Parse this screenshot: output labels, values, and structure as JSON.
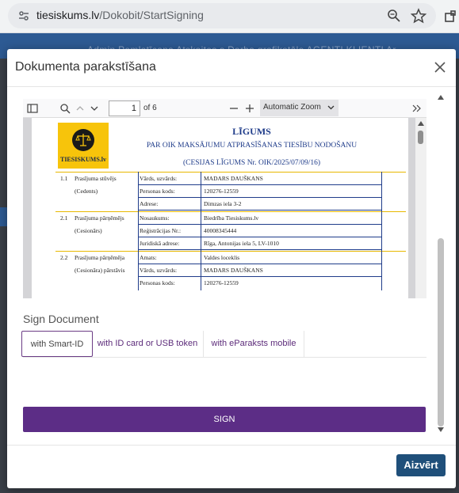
{
  "browser": {
    "url_host": "tiesiskums.lv",
    "url_path": "/Dokobit/StartSigning"
  },
  "background_app": {
    "nav_text": "Admin   Pamlatīcana   Atskaites s   Darba grafikotāle   AGENTI   KLIENTI   Ar"
  },
  "modal": {
    "title": "Dokumenta parakstīšana",
    "close_label": "Aizvērt"
  },
  "pdf_viewer": {
    "page_number": "1",
    "page_total": "of 6",
    "zoom": "Automatic Zoom"
  },
  "document": {
    "logo_text": "TIESISKUMS.lv",
    "title": "LĪGUMS",
    "subtitle": "PAR OIK MAKSĀJUMU ATPRASĪŠANAS TIESĪBU NODOŠANU",
    "ref": "(CESIJAS LĪGUMS Nr. OIK/2025/07/09/16)",
    "rows": [
      {
        "num": "1.1",
        "sec": "Prasījuma stūvējs",
        "label": "Vārds, uzvārds:",
        "value": "MADARS DAUŠKANS"
      },
      {
        "num": "",
        "sec": "(Cedents)",
        "label": "Personas kods:",
        "value": "120276-12559"
      },
      {
        "num": "",
        "sec": "",
        "label": "Adrese:",
        "value": "Dimzas iela 3-2"
      },
      {
        "num": "2.1",
        "sec": "Prasījuma pārņēmējs",
        "label": "Nosaukums:",
        "value": "Biedrība Tiesiskums.lv"
      },
      {
        "num": "",
        "sec": "(Cesionārs)",
        "label": "Reģistrācijas Nr.:",
        "value": "40008345444"
      },
      {
        "num": "",
        "sec": "",
        "label": "Juridiskā adrese:",
        "value": "Rīga, Antonijas iela 5, LV-1010"
      },
      {
        "num": "2.2",
        "sec": "Prasījuma pārņēmēja",
        "label": "Amats:",
        "value": "Valdes loceklis"
      },
      {
        "num": "",
        "sec": "(Cesionāra) pārstāvis",
        "label": "Vārds, uzvārds:",
        "value": "MADARS DAUŠKANS"
      },
      {
        "num": "",
        "sec": "",
        "label": "Personas kods:",
        "value": "120276-12559"
      }
    ]
  },
  "sign": {
    "heading": "Sign Document",
    "tabs": [
      "with Smart-ID",
      "with ID card or USB token",
      "with eParaksts mobile"
    ],
    "button_label": "SIGN"
  }
}
